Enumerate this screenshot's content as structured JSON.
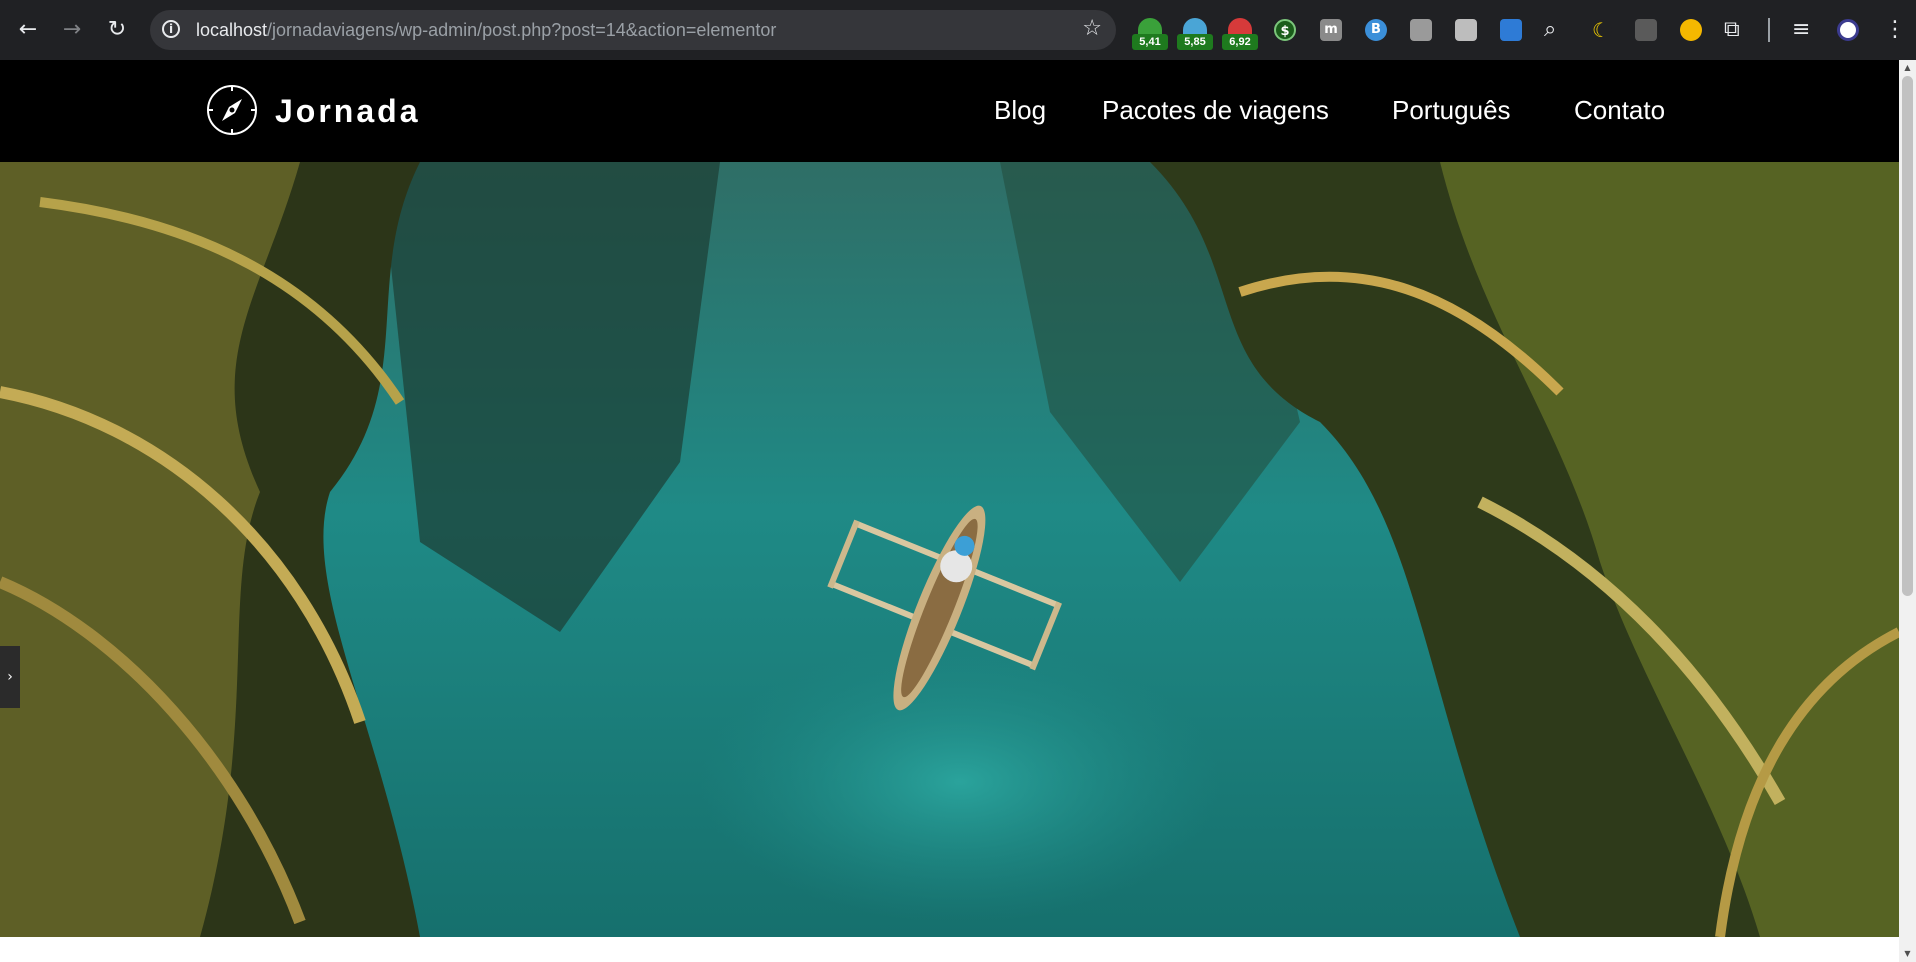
{
  "browser": {
    "back_icon": "←",
    "forward_icon": "→",
    "reload_icon": "↻",
    "site_info_icon": "i",
    "url_host": "localhost",
    "url_path": "/jornadaviagens/wp-admin/post.php?post=14&action=elementor",
    "bookmark_icon": "☆",
    "extensions": {
      "badge_1": "5,41",
      "badge_2": "5,85",
      "badge_3": "6,92",
      "dollar": "$",
      "m": "m",
      "b": "B"
    }
  },
  "site": {
    "logo_text": "Jornada",
    "menu": [
      "Blog",
      "Pacotes de viagens",
      "Português",
      "Contato"
    ]
  },
  "editor": {
    "panel_toggle_icon": "›"
  },
  "colors": {
    "header_bg": "#000000",
    "water": "#1f8a86",
    "foliage": "#3c4a22"
  }
}
